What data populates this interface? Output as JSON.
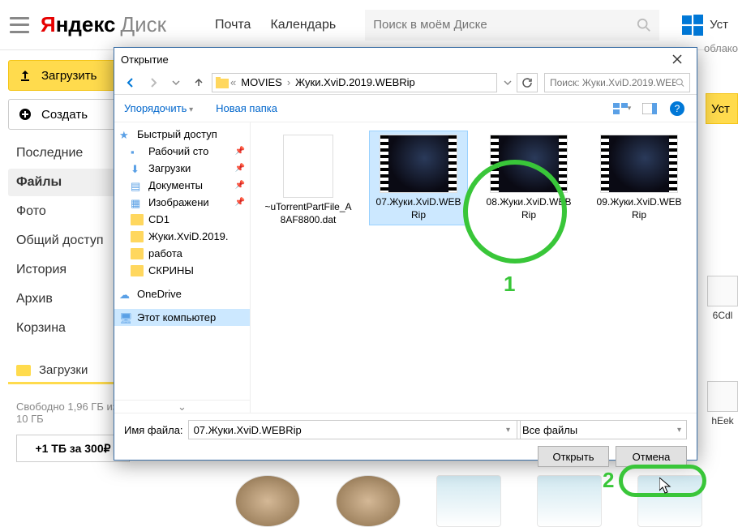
{
  "header": {
    "logo_y": "Я",
    "logo_rest": "ндекс",
    "logo_disk": "Диск",
    "nav_mail": "Почта",
    "nav_calendar": "Календарь",
    "search_placeholder": "Поиск в моём Диске",
    "install_label": "Уст",
    "cloud_hint": "облако"
  },
  "sidebar": {
    "upload_label": "Загрузить",
    "create_label": "Создать",
    "items": [
      {
        "label": "Последние"
      },
      {
        "label": "Файлы"
      },
      {
        "label": "Фото"
      },
      {
        "label": "Общий доступ"
      },
      {
        "label": "История"
      },
      {
        "label": "Архив"
      },
      {
        "label": "Корзина"
      }
    ],
    "downloads_label": "Загрузки",
    "quota": "Свободно 1,96 ГБ из 10 ГБ",
    "plus_btn": "+1 ТБ за 300₽"
  },
  "right_btn": "Уст",
  "right_items": {
    "r1": "6Cdl",
    "r2": "hEek"
  },
  "dialog": {
    "title": "Открытие",
    "breadcrumb": {
      "seg1": "MOVIES",
      "seg2": "Жуки.XviD.2019.WEBRip"
    },
    "search_placeholder": "Поиск: Жуки.XviD.2019.WEB...",
    "toolbar": {
      "organize": "Упорядочить",
      "new_folder": "Новая папка"
    },
    "tree": [
      {
        "label": "Быстрый доступ",
        "icon": "star"
      },
      {
        "label": "Рабочий сто",
        "icon": "blue",
        "pinned": true
      },
      {
        "label": "Загрузки",
        "icon": "blue",
        "pinned": true
      },
      {
        "label": "Документы",
        "icon": "blue",
        "pinned": true
      },
      {
        "label": "Изображени",
        "icon": "blue",
        "pinned": true
      },
      {
        "label": "CD1",
        "icon": "folder"
      },
      {
        "label": "Жуки.XviD.2019.",
        "icon": "folder"
      },
      {
        "label": "работа",
        "icon": "folder"
      },
      {
        "label": "СКРИНЫ",
        "icon": "folder"
      },
      {
        "label": "OneDrive",
        "icon": "cloud"
      },
      {
        "label": "Этот компьютер",
        "icon": "pc",
        "selected": true
      }
    ],
    "files": [
      {
        "name": "~uTorrentPartFile_A8AF8800.dat",
        "type": "doc"
      },
      {
        "name": "07.Жуки.XviD.WEBRip",
        "type": "video",
        "selected": true
      },
      {
        "name": "08.Жуки.XviD.WEBRip",
        "type": "video"
      },
      {
        "name": "09.Жуки.XviD.WEBRip",
        "type": "video"
      }
    ],
    "footer": {
      "filename_label": "Имя файла:",
      "filename_value": "07.Жуки.XviD.WEBRip",
      "filetype": "Все файлы",
      "open_btn": "Открыть",
      "cancel_btn": "Отмена"
    }
  },
  "anno": {
    "n1": "1",
    "n2": "2"
  }
}
